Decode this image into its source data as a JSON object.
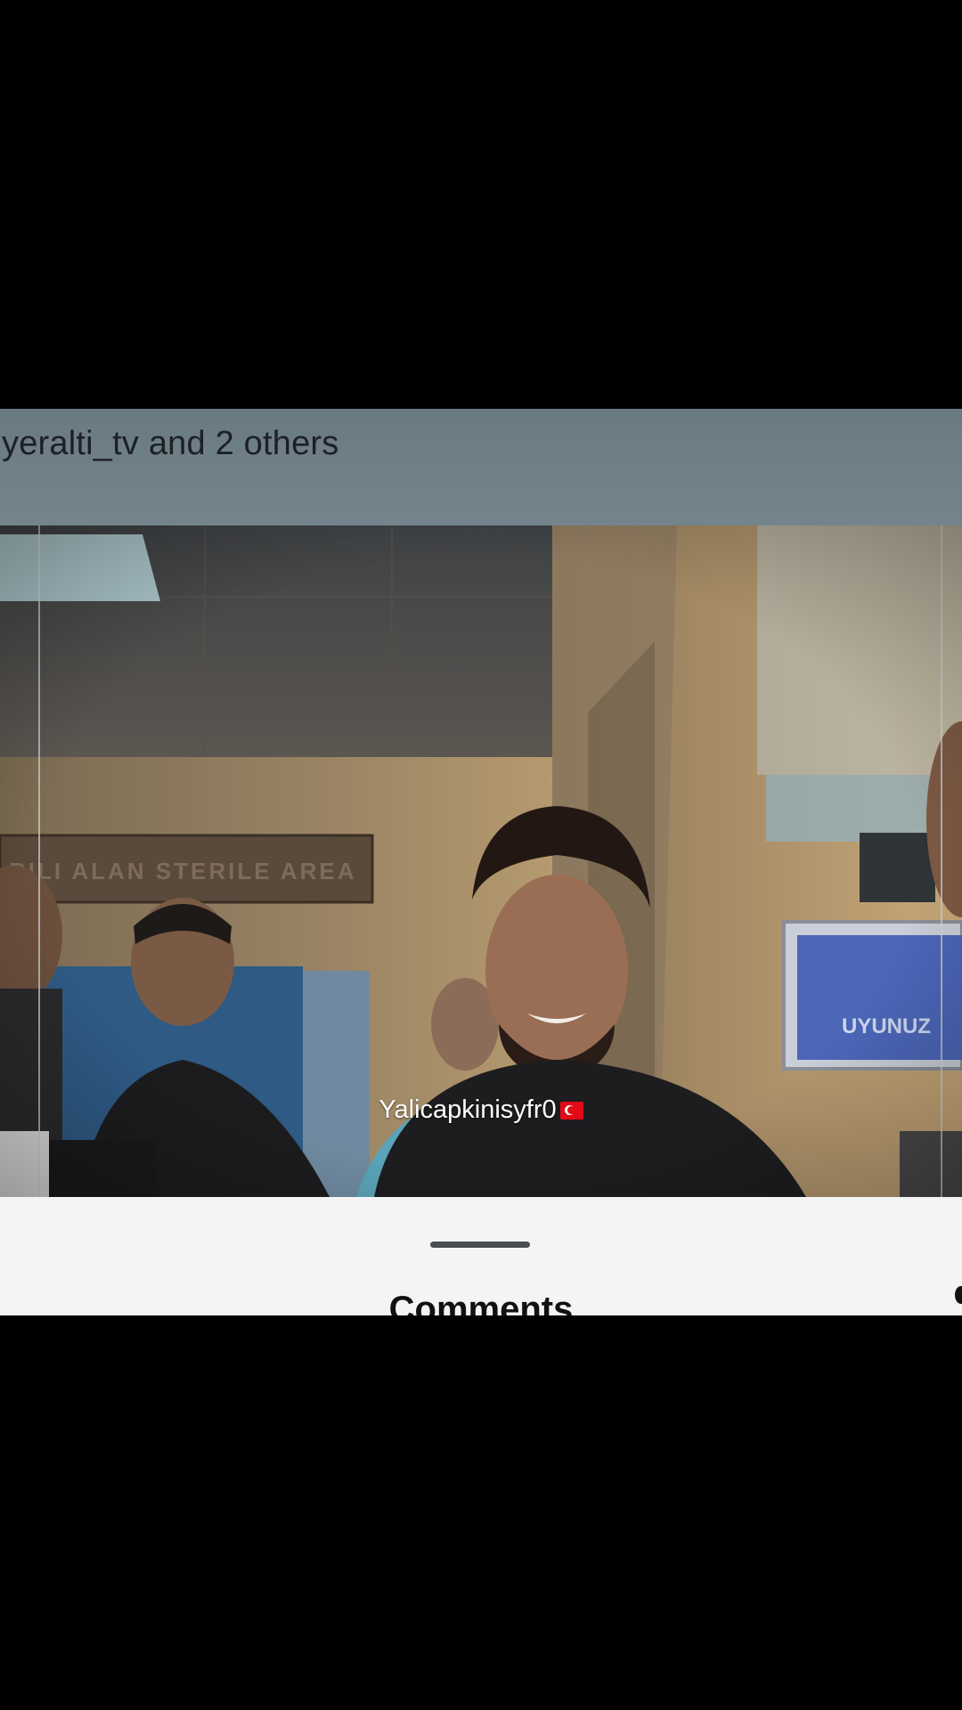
{
  "post": {
    "collaborators_text": "yeralti_tv and 2 others"
  },
  "video": {
    "overlay_username": "Yalicapkinisyfr0",
    "flag_icon": "turkey-flag-icon",
    "signs": {
      "wall_sign": "RILI ALAN   STERILE AREA",
      "right_sign": "UYUNUZ"
    }
  },
  "sheet": {
    "title": "Comments"
  },
  "colors": {
    "background": "#000000",
    "caption_band": "#6f7f87",
    "sheet": "#f4f4f5"
  }
}
